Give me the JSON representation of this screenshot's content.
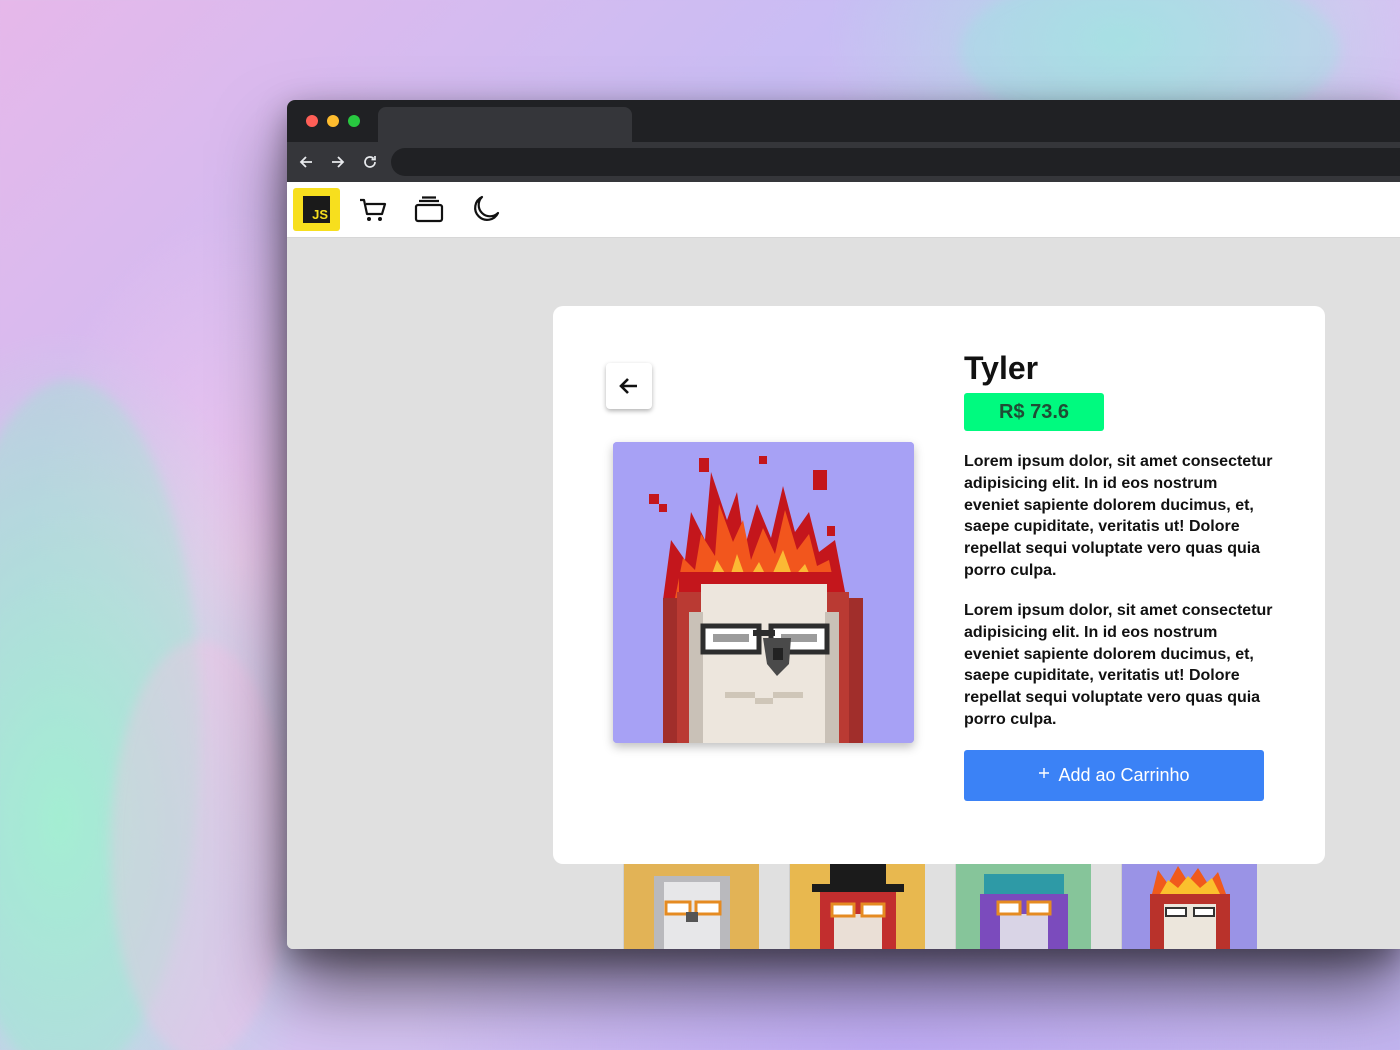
{
  "window": {
    "traffic_lights": [
      "#ff5f57",
      "#febc2e",
      "#28c840"
    ]
  },
  "nav": {
    "back_icon": "arrow-left-icon",
    "forward_icon": "arrow-right-icon",
    "reload_icon": "reload-icon"
  },
  "appbar": {
    "logo_text": "JS",
    "icons": [
      "cart-icon",
      "collection-icon",
      "moon-icon"
    ]
  },
  "product": {
    "name": "Tyler",
    "price": "R$ 73.6",
    "description_1": "Lorem ipsum dolor, sit amet consectetur adipisicing elit. In id eos nostrum eveniet sapiente dolorem ducimus, et, saepe cupiditate, veritatis ut! Dolore repellat sequi voluptate vero quas quia porro culpa.",
    "description_2": "Lorem ipsum dolor, sit amet consectetur adipisicing elit. In id eos nostrum eveniet sapiente dolorem ducimus, et, saepe cupiditate, veritatis ut! Dolore repellat sequi voluptate vero quas quia porro culpa.",
    "add_button_label": "Add ao Carrinho",
    "add_button_icon": "plus-icon",
    "back_button_icon": "arrow-left-icon"
  },
  "colors": {
    "price_badge": "#00fa7f",
    "add_button": "#3b82f6",
    "js_yellow": "#f7df1e"
  },
  "thumbnails": [
    {
      "name": "white-owl",
      "bg": "#e2b356"
    },
    {
      "name": "top-hat-owl",
      "bg": "#e8b84f"
    },
    {
      "name": "turban-owl",
      "bg": "#86c59a"
    },
    {
      "name": "fire-owl",
      "bg": "#9a93e6"
    }
  ]
}
